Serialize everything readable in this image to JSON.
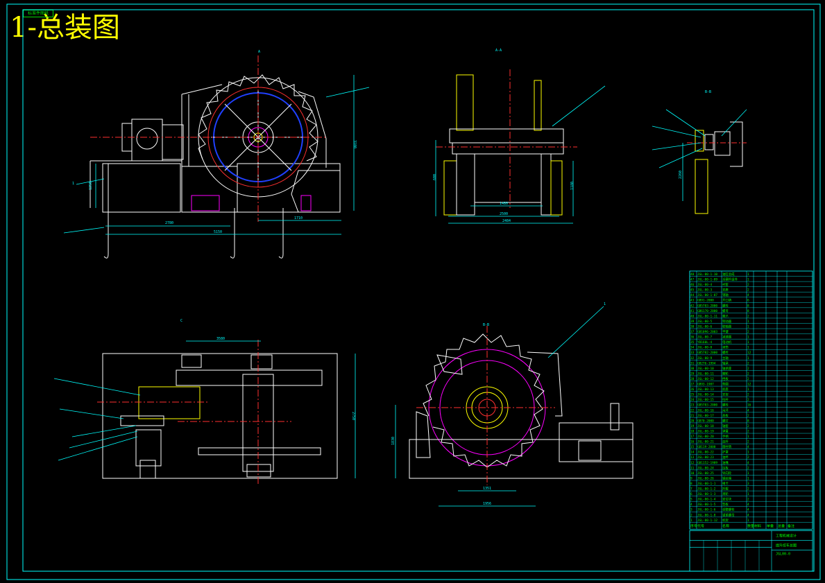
{
  "sheet_title": "1-总装图",
  "stamp_label": "标准件图纸",
  "views": {
    "front": {
      "section_mark": "A",
      "dim_height": "3100",
      "dim_left_height": "1250",
      "dim_total": "5150",
      "dim_inner": "2780",
      "dim_right": "1710",
      "balloon": "1"
    },
    "side": {
      "title": "A-A",
      "dim_inner": "1480",
      "dim_total1": "2500",
      "dim_total2": "2484",
      "dim_height": "1180",
      "dim_left": "600"
    },
    "detail": {
      "title": "B-B",
      "dim_vertical": "2260"
    },
    "top": {
      "section_mark": "C",
      "dim_top": "3580",
      "dim_height": "2750"
    },
    "section_bb": {
      "title": "B-B",
      "dim_height": "1830",
      "dim_inner": "1351",
      "dim_outer": "1956",
      "balloon": "1"
    }
  },
  "bom": {
    "rows": [
      {
        "no": "48",
        "code": "JGL-00-1-10",
        "name": "油缸总成",
        "qty": "1",
        "note": ""
      },
      {
        "no": "47",
        "code": "JGL-00-1-09",
        "name": "活塞杆组件",
        "qty": "1",
        "note": ""
      },
      {
        "no": "46",
        "code": "JGL-00-4",
        "name": "衬套",
        "qty": "2",
        "note": ""
      },
      {
        "no": "45",
        "code": "JGL-00-3",
        "name": "支座",
        "qty": "2",
        "note": ""
      },
      {
        "no": "44",
        "code": "JGL-00-1-07",
        "name": "销轴",
        "qty": "4",
        "note": ""
      },
      {
        "no": "43",
        "code": "GB91-2000",
        "name": "开口销",
        "qty": "6",
        "note": ""
      },
      {
        "no": "42",
        "code": "GB5783-2000",
        "name": "螺栓",
        "qty": "8",
        "note": ""
      },
      {
        "no": "41",
        "code": "GB6170-2000",
        "name": "螺母",
        "qty": "8",
        "note": ""
      },
      {
        "no": "40",
        "code": "JGL-00-1-11",
        "name": "棘爪",
        "qty": "2",
        "note": ""
      },
      {
        "no": "39",
        "code": "JGL-00-5",
        "name": "制动器",
        "qty": "1",
        "note": ""
      },
      {
        "no": "38",
        "code": "JGL-00-6",
        "name": "联轴器",
        "qty": "1",
        "note": ""
      },
      {
        "no": "37",
        "code": "GB1096-2003",
        "name": "平键",
        "qty": "2",
        "note": ""
      },
      {
        "no": "36",
        "code": "JGL-00-7",
        "name": "减速器",
        "qty": "1",
        "note": ""
      },
      {
        "no": "35",
        "code": "YB160L-4",
        "name": "电动机",
        "qty": "1",
        "note": ""
      },
      {
        "no": "34",
        "code": "JGL-00-8",
        "name": "滚筒",
        "qty": "1",
        "note": ""
      },
      {
        "no": "33",
        "code": "GB5782-2000",
        "name": "螺栓",
        "qty": "12",
        "note": ""
      },
      {
        "no": "32",
        "code": "JGL-00-9",
        "name": "主轴",
        "qty": "1",
        "note": ""
      },
      {
        "no": "31",
        "code": "GB276-1994",
        "name": "轴承",
        "qty": "2",
        "note": ""
      },
      {
        "no": "30",
        "code": "JGL-00-10",
        "name": "轴承座",
        "qty": "2",
        "note": ""
      },
      {
        "no": "29",
        "code": "JGL-00-11",
        "name": "棘轮",
        "qty": "2",
        "note": ""
      },
      {
        "no": "28",
        "code": "JGL-00-12",
        "name": "挡板",
        "qty": "2",
        "note": ""
      },
      {
        "no": "27",
        "code": "GB93-1987",
        "name": "垫圈",
        "qty": "12",
        "note": ""
      },
      {
        "no": "26",
        "code": "JGL-00-13",
        "name": "底座",
        "qty": "1",
        "note": ""
      },
      {
        "no": "25",
        "code": "JGL-00-14",
        "name": "支架",
        "qty": "2",
        "note": ""
      },
      {
        "no": "24",
        "code": "JGL-00-15",
        "name": "拉杆",
        "qty": "2",
        "note": ""
      },
      {
        "no": "23",
        "code": "GB5783-2000",
        "name": "螺栓",
        "qty": "16",
        "note": ""
      },
      {
        "no": "22",
        "code": "JGL-00-16",
        "name": "吊环",
        "qty": "4",
        "note": ""
      },
      {
        "no": "21",
        "code": "JGL-00-17",
        "name": "盖板",
        "qty": "2",
        "note": ""
      },
      {
        "no": "20",
        "code": "GB70-2000",
        "name": "螺钉",
        "qty": "8",
        "note": ""
      },
      {
        "no": "19",
        "code": "JGL-00-18",
        "name": "轴套",
        "qty": "2",
        "note": ""
      },
      {
        "no": "18",
        "code": "JGL-00-19",
        "name": "弹簧",
        "qty": "2",
        "note": ""
      },
      {
        "no": "17",
        "code": "JGL-00-20",
        "name": "手柄",
        "qty": "1",
        "note": ""
      },
      {
        "no": "16",
        "code": "JGL-00-21",
        "name": "连杆",
        "qty": "2",
        "note": ""
      },
      {
        "no": "15",
        "code": "GB119-2000",
        "name": "圆柱销",
        "qty": "4",
        "note": ""
      },
      {
        "no": "14",
        "code": "JGL-00-22",
        "name": "护罩",
        "qty": "1",
        "note": ""
      },
      {
        "no": "13",
        "code": "JGL-00-23",
        "name": "油杯",
        "qty": "2",
        "note": ""
      },
      {
        "no": "12",
        "code": "GB1152-1989",
        "name": "油嘴",
        "qty": "4",
        "note": ""
      },
      {
        "no": "11",
        "code": "JGL-00-24",
        "name": "压板",
        "qty": "2",
        "note": ""
      },
      {
        "no": "10",
        "code": "JGL-00-25",
        "name": "导向轮",
        "qty": "1",
        "note": ""
      },
      {
        "no": "9",
        "code": "JGL-00-26",
        "name": "钢丝绳",
        "qty": "1",
        "note": ""
      },
      {
        "no": "8",
        "code": "JGL-00-1-1",
        "name": "绳卡",
        "qty": "3",
        "note": ""
      },
      {
        "no": "7",
        "code": "JGL-00-1-2",
        "name": "托辊",
        "qty": "2",
        "note": ""
      },
      {
        "no": "6",
        "code": "JGL-00-1-3",
        "name": "滑轮",
        "qty": "1",
        "note": ""
      },
      {
        "no": "5",
        "code": "JGL-00-1-4",
        "name": "定位块",
        "qty": "2",
        "note": ""
      },
      {
        "no": "4",
        "code": "JGL-00-1-5",
        "name": "垫板",
        "qty": "4",
        "note": ""
      },
      {
        "no": "3",
        "code": "JGL-00-1-6",
        "name": "调整螺栓",
        "qty": "4",
        "note": ""
      },
      {
        "no": "2",
        "code": "JGL-00-1-8",
        "name": "锁紧螺母",
        "qty": "4",
        "note": ""
      },
      {
        "no": "1",
        "code": "JGL-00-1-12",
        "name": "机架",
        "qty": "1",
        "note": ""
      }
    ],
    "header": [
      "序号",
      "代号",
      "名称",
      "数量",
      "材料",
      "单重",
      "总重",
      "备注"
    ],
    "company": "工程机械设计",
    "drawing_title": "提升绞车总图",
    "drawing_no": "JGL00-0"
  },
  "colors": {
    "frame": "#00ffff",
    "geometry": "#ffffff",
    "dims": "#00ffff",
    "centerline": "#ff3030",
    "hidden": "#ffff00",
    "accent": "#ff00ff",
    "blue": "#2040ff",
    "bom_text": "#00ff00",
    "title": "#ffff00"
  }
}
